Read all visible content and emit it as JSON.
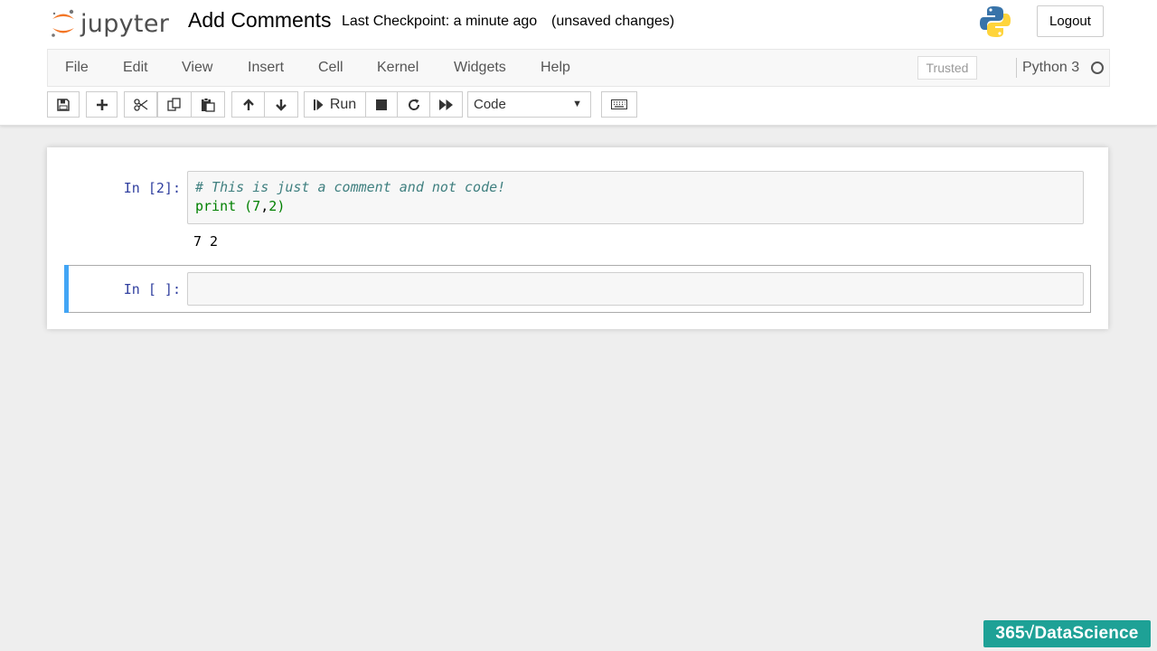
{
  "header": {
    "logo_text": "jupyter",
    "notebook_title": "Add Comments",
    "checkpoint": "Last Checkpoint: a minute ago",
    "unsaved": "(unsaved changes)",
    "logout_label": "Logout"
  },
  "menubar": {
    "items": [
      "File",
      "Edit",
      "View",
      "Insert",
      "Cell",
      "Kernel",
      "Widgets",
      "Help"
    ],
    "trusted_label": "Trusted",
    "kernel_name": "Python 3"
  },
  "toolbar": {
    "run_label": "Run",
    "cell_type": "Code",
    "icons": [
      "save-icon",
      "plus-icon",
      "cut-icon",
      "copy-icon",
      "paste-icon",
      "arrow-up-icon",
      "arrow-down-icon",
      "step-forward-icon",
      "stop-icon",
      "restart-icon",
      "fast-forward-icon",
      "keyboard-icon"
    ]
  },
  "cells": [
    {
      "prompt": "In [2]:",
      "comment_line": "# This is just a comment and not code!",
      "code_print": "print",
      "code_args_open": " (",
      "code_arg1": "7",
      "code_comma": ",",
      "code_arg2": "2",
      "code_args_close": ")",
      "output": "7 2"
    },
    {
      "prompt": "In [ ]:"
    }
  ],
  "watermark": "365√DataScience",
  "colors": {
    "prompt": "#303f9f",
    "comment": "#408080",
    "selected_bar": "#42a5f5",
    "watermark_bg": "#1ea196"
  }
}
